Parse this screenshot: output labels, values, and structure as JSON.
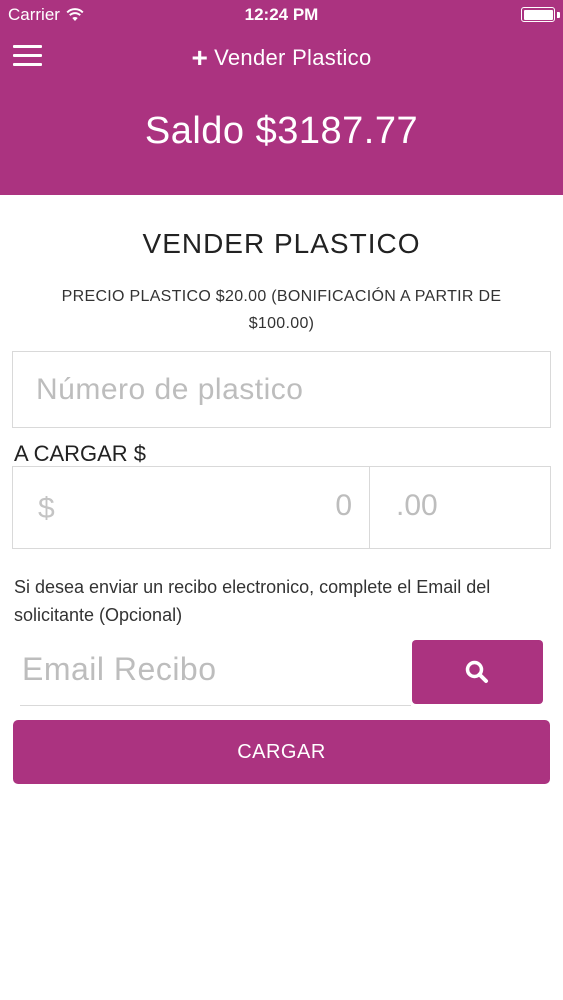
{
  "status_bar": {
    "carrier": "Carrier",
    "time": "12:24 PM"
  },
  "header": {
    "title": "Vender Plastico",
    "title_icon": "plus-icon",
    "balance": "Saldo $3187.77",
    "color": "#ab3380"
  },
  "form": {
    "section_title": "VENDER PLASTICO",
    "price_note": "PRECIO PLASTICO $20.00 (BONIFICACIÓN A PARTIR DE $100.00)",
    "plastic_number_placeholder": "Número de plastico",
    "amount_label": "A CARGAR $",
    "currency_symbol": "$",
    "amount_value": "0",
    "decimal_value": ".00",
    "receipt_note": "Si desea enviar un recibo electronico, complete el Email del solicitante (Opcional)",
    "email_placeholder": "Email Recibo",
    "search_icon": "search-icon",
    "submit_label": "CARGAR"
  }
}
